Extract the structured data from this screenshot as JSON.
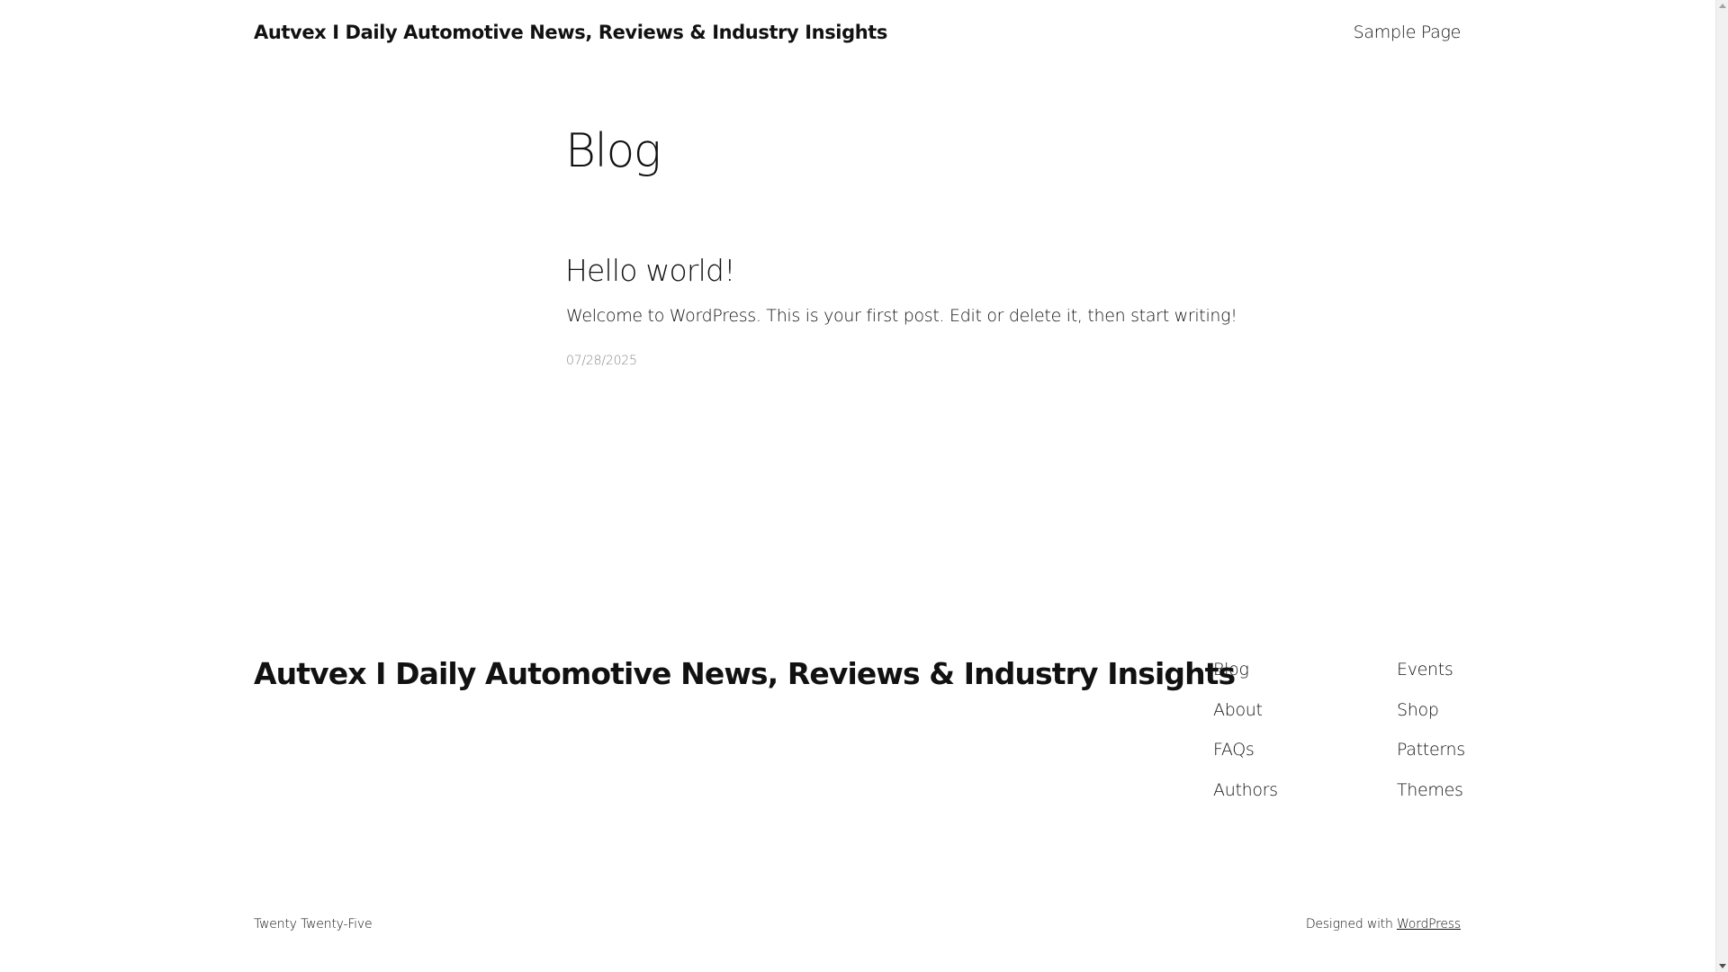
{
  "header": {
    "site_title": "Autvex I Daily Automotive News, Reviews & Industry Insights",
    "nav_items": [
      {
        "label": "Sample Page"
      }
    ]
  },
  "main": {
    "page_heading": "Blog",
    "posts": [
      {
        "title": "Hello world!",
        "excerpt": "Welcome to WordPress. This is your first post. Edit or delete it, then start writing!",
        "date": "07/28/2025"
      }
    ]
  },
  "footer": {
    "site_title": "Autvex I Daily Automotive News, Reviews & Industry Insights",
    "nav_columns": [
      {
        "links": [
          "Blog",
          "About",
          "FAQs",
          "Authors"
        ]
      },
      {
        "links": [
          "Events",
          "Shop",
          "Patterns",
          "Themes"
        ]
      }
    ],
    "theme_credit": "Twenty Twenty-Five",
    "designed_with_text": "Designed with",
    "designed_with_link": "WordPress"
  },
  "colors": {
    "text": "#111111",
    "muted": "#8a8a8a",
    "background": "#ffffff"
  }
}
